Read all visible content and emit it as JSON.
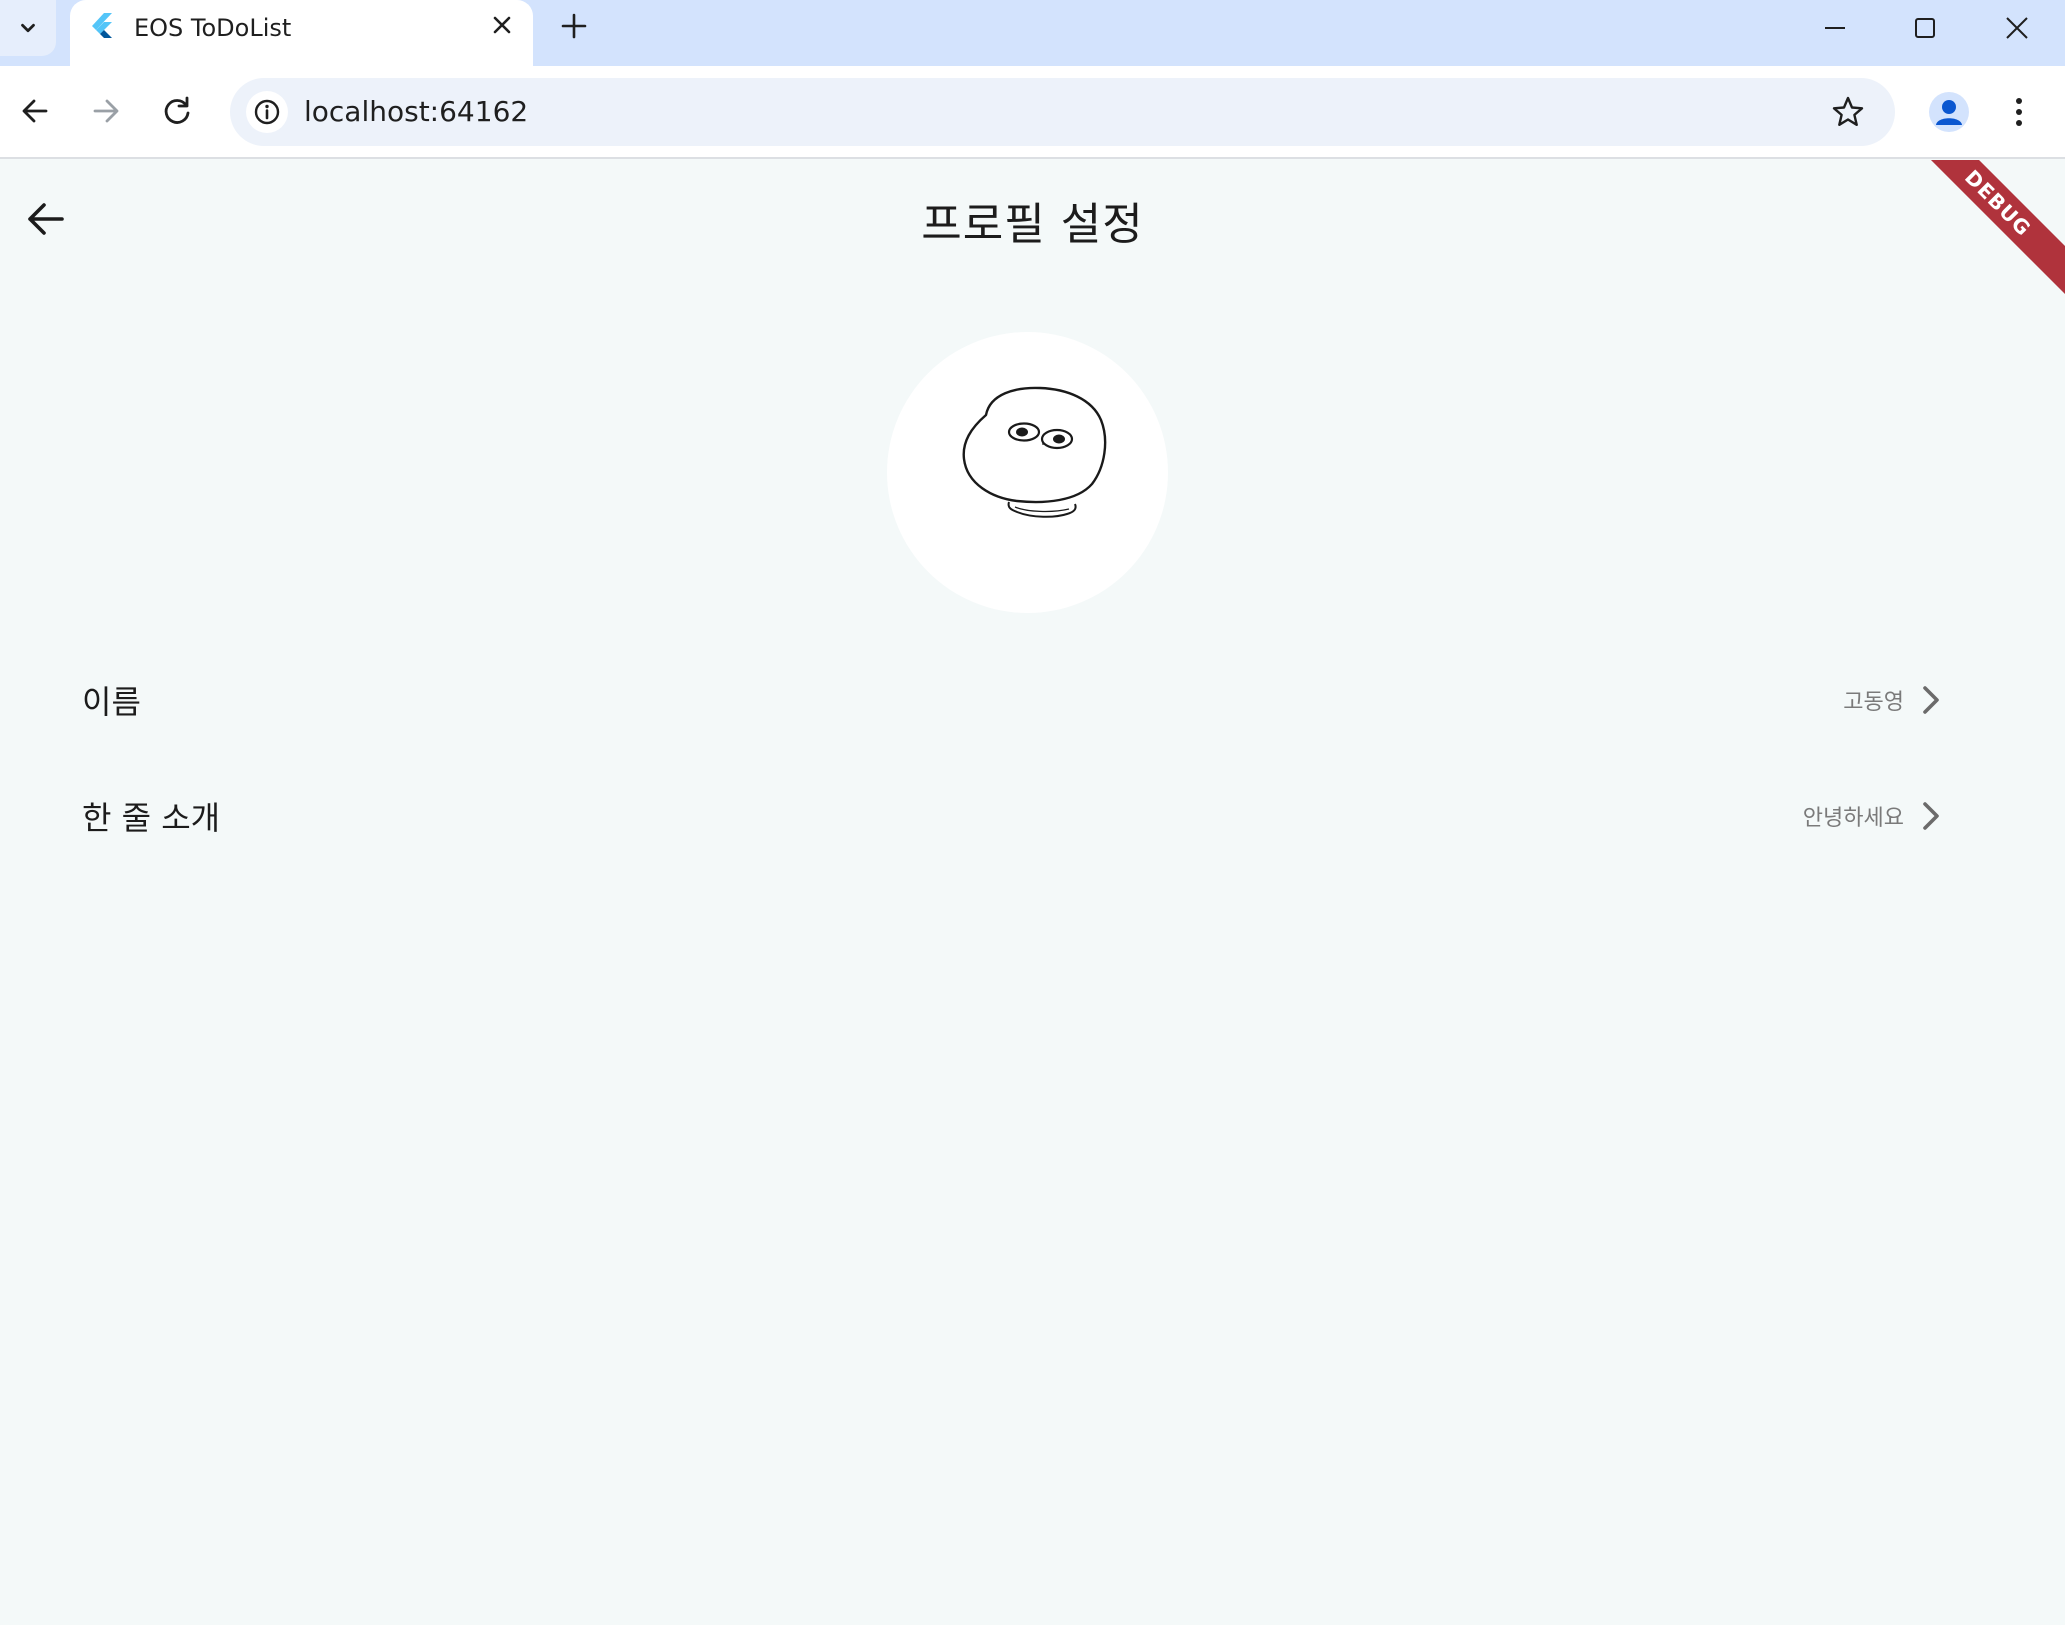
{
  "browser": {
    "tab_title": "EOS ToDoList",
    "url": "localhost:64162"
  },
  "app": {
    "page_title": "프로필 설정",
    "debug_banner": "DEBUG",
    "settings": [
      {
        "label": "이름",
        "value": "고동영"
      },
      {
        "label": "한 줄 소개",
        "value": "안녕하세요"
      }
    ]
  }
}
